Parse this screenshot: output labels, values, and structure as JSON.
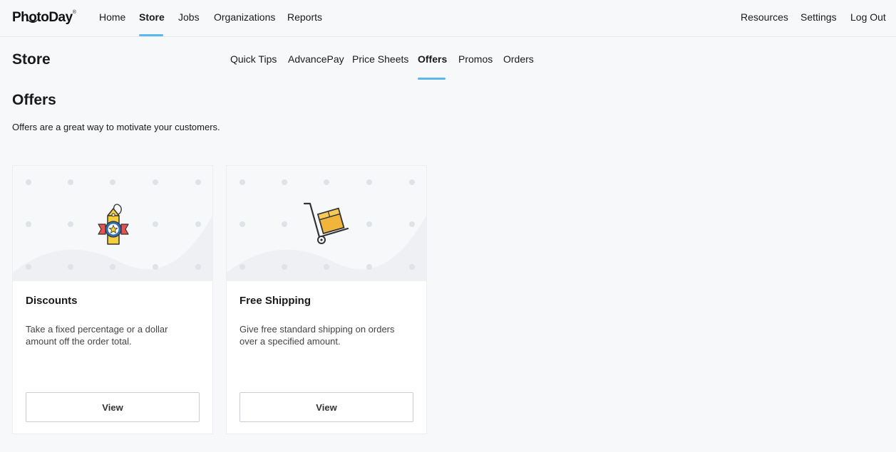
{
  "logo": {
    "text": "PhotoDay",
    "reg": "®"
  },
  "topnav": {
    "left": [
      "Home",
      "Store",
      "Jobs",
      "Organizations",
      "Reports"
    ],
    "right": [
      "Resources",
      "Settings",
      "Log Out"
    ],
    "active": "Store"
  },
  "section_title": "Store",
  "subnav": {
    "items": [
      "Quick Tips",
      "AdvancePay",
      "Price Sheets",
      "Offers",
      "Promos",
      "Orders"
    ],
    "active": "Offers"
  },
  "page": {
    "heading": "Offers",
    "description": "Offers are a great way to motivate your customers."
  },
  "cards": [
    {
      "icon": "discount-tag-icon",
      "title": "Discounts",
      "text": "Take a fixed percentage or a dollar amount off the order total.",
      "button": "View"
    },
    {
      "icon": "hand-truck-icon",
      "title": "Free Shipping",
      "text": "Give free standard shipping on orders over a specified amount.",
      "button": "View"
    }
  ],
  "colors": {
    "accent": "#5bb8ec",
    "background": "#f7f8fa",
    "tag_yellow": "#f5cf3b",
    "box_orange": "#f2b53c",
    "ribbon_red": "#e8514e",
    "badge_blue": "#2f6fb5"
  }
}
